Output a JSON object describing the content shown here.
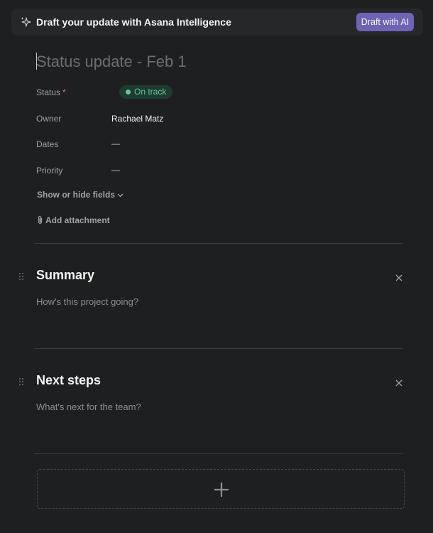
{
  "banner": {
    "text": "Draft your update with Asana Intelligence",
    "button_label": "Draft with AI",
    "icon": "sparkle-icon"
  },
  "title": {
    "placeholder": "Status update - Feb 1",
    "value": ""
  },
  "fields": {
    "status": {
      "label": "Status",
      "required_marker": "*",
      "value": "On track",
      "color": "#5fc89b"
    },
    "owner": {
      "label": "Owner",
      "value": "Rachael Matz"
    },
    "dates": {
      "label": "Dates",
      "value": "—"
    },
    "priority": {
      "label": "Priority",
      "value": "—"
    }
  },
  "show_hide_label": "Show or hide fields",
  "add_attachment_label": "Add attachment",
  "sections": [
    {
      "title": "Summary",
      "placeholder": "How's this project going?"
    },
    {
      "title": "Next steps",
      "placeholder": "What's next for the team?"
    }
  ],
  "colors": {
    "background": "#1e1f21",
    "banner_bg": "#26272a",
    "accent_button": "#6d64b5",
    "on_track": "#5fc89b"
  }
}
